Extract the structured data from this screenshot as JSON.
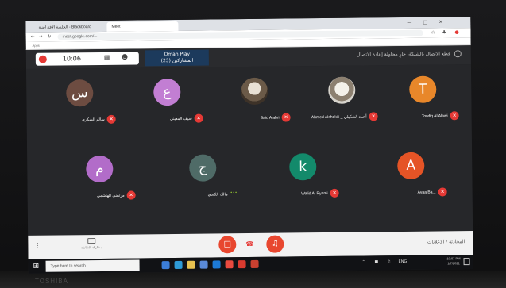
{
  "browser": {
    "tabs": [
      {
        "label": "الجلسة الإفتراضية - Blackboard"
      },
      {
        "label": "Meet"
      }
    ],
    "url": "meet.google.com/...",
    "bookmarks": [
      "Apps",
      "",
      "",
      "",
      "",
      "",
      ""
    ]
  },
  "meeting": {
    "timer": "10:06",
    "title_line1": "Oman Play",
    "title_line2": "(23) المشاركين",
    "topbar_text": "قطع الاتصال بالشبكة، جارٍ محاولة إعادة الاتصال",
    "chat_label": "المحادثة / الإعلانات",
    "share_label": "مشاركة الشاشة"
  },
  "participants": [
    {
      "name": "سالم الشكري",
      "initial": "س",
      "color": "#6d4c41"
    },
    {
      "name": "سيف المعيني",
      "initial": "ع",
      "color": "#c27ed3"
    },
    {
      "name": "Said Alabri",
      "initial": "",
      "color": "photo"
    },
    {
      "name": "Ahmed Alshekili _ أحمد الشكيلي",
      "initial": "",
      "color": "photo2"
    },
    {
      "name": "Towfiq Al Alawi",
      "initial": "T",
      "color": "#e8872a"
    },
    {
      "name": "مرتضى الهاشمي",
      "initial": "م",
      "color": "#b26cc9"
    },
    {
      "name": "مالك الكندي",
      "initial": "ج",
      "color": "#4f6b67"
    },
    {
      "name": "Walid Al Ryami",
      "initial": "k",
      "color": "#138a6b"
    },
    {
      "name": "Ayaa Ba...",
      "initial": "A",
      "color": "#e55426"
    }
  ],
  "taskbar": {
    "search_placeholder": "Type here to search",
    "time": "10:07 PM",
    "date": "1/7/2021",
    "lang": "ENG"
  },
  "brand": "TOSHIBA"
}
